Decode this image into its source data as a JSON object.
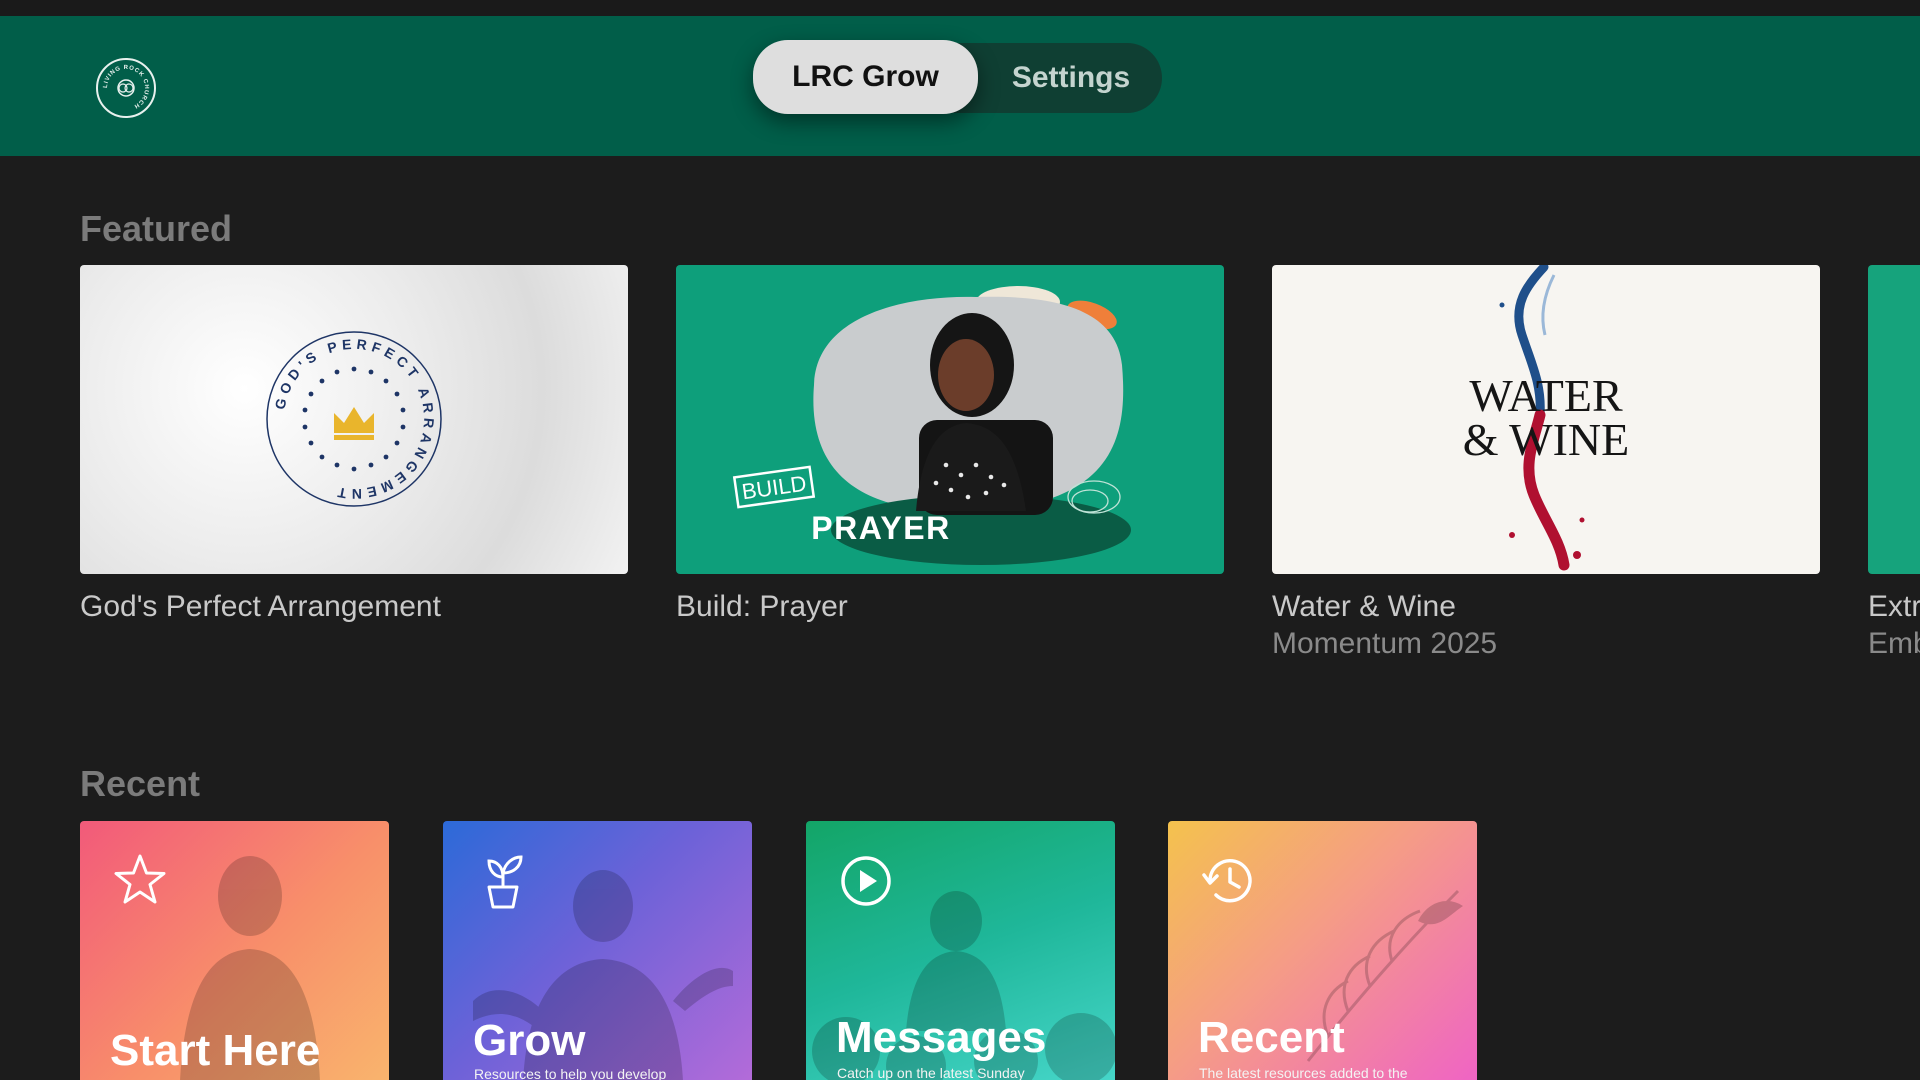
{
  "header": {
    "logo_text": "LIVING ROCK CHURCH",
    "tabs": [
      {
        "label": "LRC Grow",
        "active": true
      },
      {
        "label": "Settings",
        "active": false
      }
    ]
  },
  "featured": {
    "title": "Featured",
    "items": [
      {
        "title": "God's Perfect Arrangement",
        "subtitle": "",
        "art_text": "GOD'S PERFECT ARRANGEMENT"
      },
      {
        "title": "Build: Prayer",
        "subtitle": "",
        "art_badge": "BUILD",
        "art_text": "PRAYER"
      },
      {
        "title": "Water & Wine",
        "subtitle": "Momentum 2025",
        "art_line1": "WATER",
        "art_line2": "& WINE"
      },
      {
        "title": "Extr",
        "subtitle": "Emb"
      }
    ]
  },
  "recent": {
    "title": "Recent",
    "items": [
      {
        "title": "Start Here",
        "description": "",
        "icon": "star-icon"
      },
      {
        "title": "Grow",
        "description": "Resources to help you develop",
        "icon": "plant-icon"
      },
      {
        "title": "Messages",
        "description": "Catch up on the latest Sunday",
        "icon": "play-circle-icon"
      },
      {
        "title": "Recent",
        "description": "The latest resources added to the",
        "icon": "history-icon"
      }
    ]
  },
  "colors": {
    "header_bg": "#015e49",
    "page_bg": "#1c1c1c",
    "tab_active_bg": "#dedede",
    "prayer_card_bg": "#0e9f7b"
  }
}
